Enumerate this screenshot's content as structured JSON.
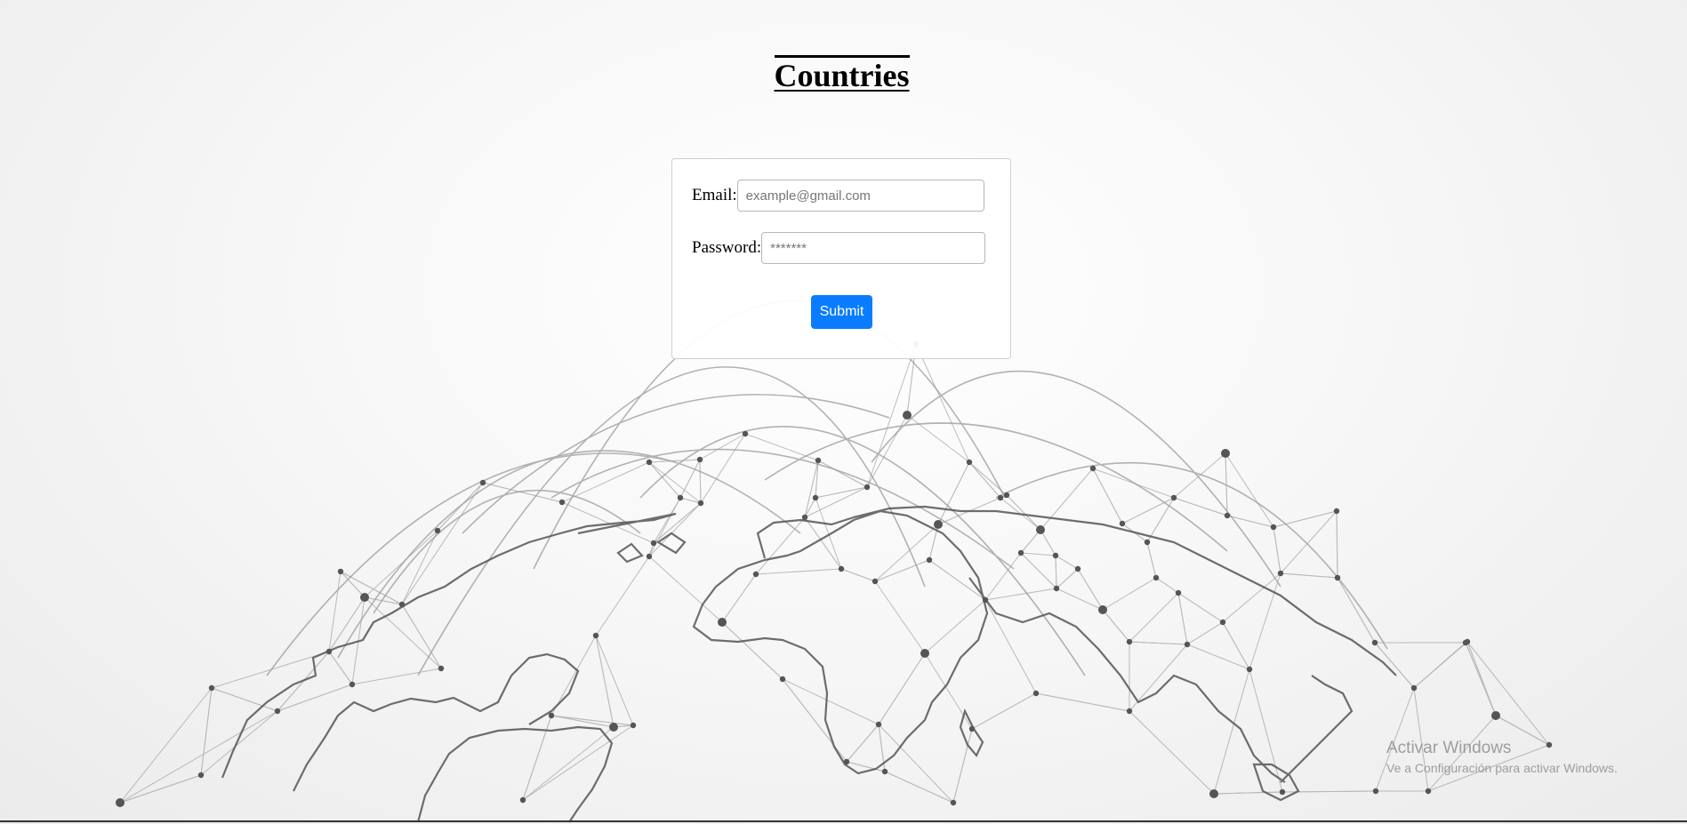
{
  "page": {
    "title": "Countries"
  },
  "form": {
    "email": {
      "label": "Email:",
      "placeholder": "example@gmail.com",
      "value": ""
    },
    "password": {
      "label": "Password:",
      "placeholder": "*******",
      "value": ""
    },
    "submit_label": "Submit"
  },
  "watermark": {
    "title": "Activar Windows",
    "subtitle": "Ve a Configuración para activar Windows."
  },
  "colors": {
    "accent": "#0a7cff",
    "background": "#f5f5f5",
    "map_lines": "#555555"
  },
  "icons": {
    "background": "world-network-map"
  }
}
